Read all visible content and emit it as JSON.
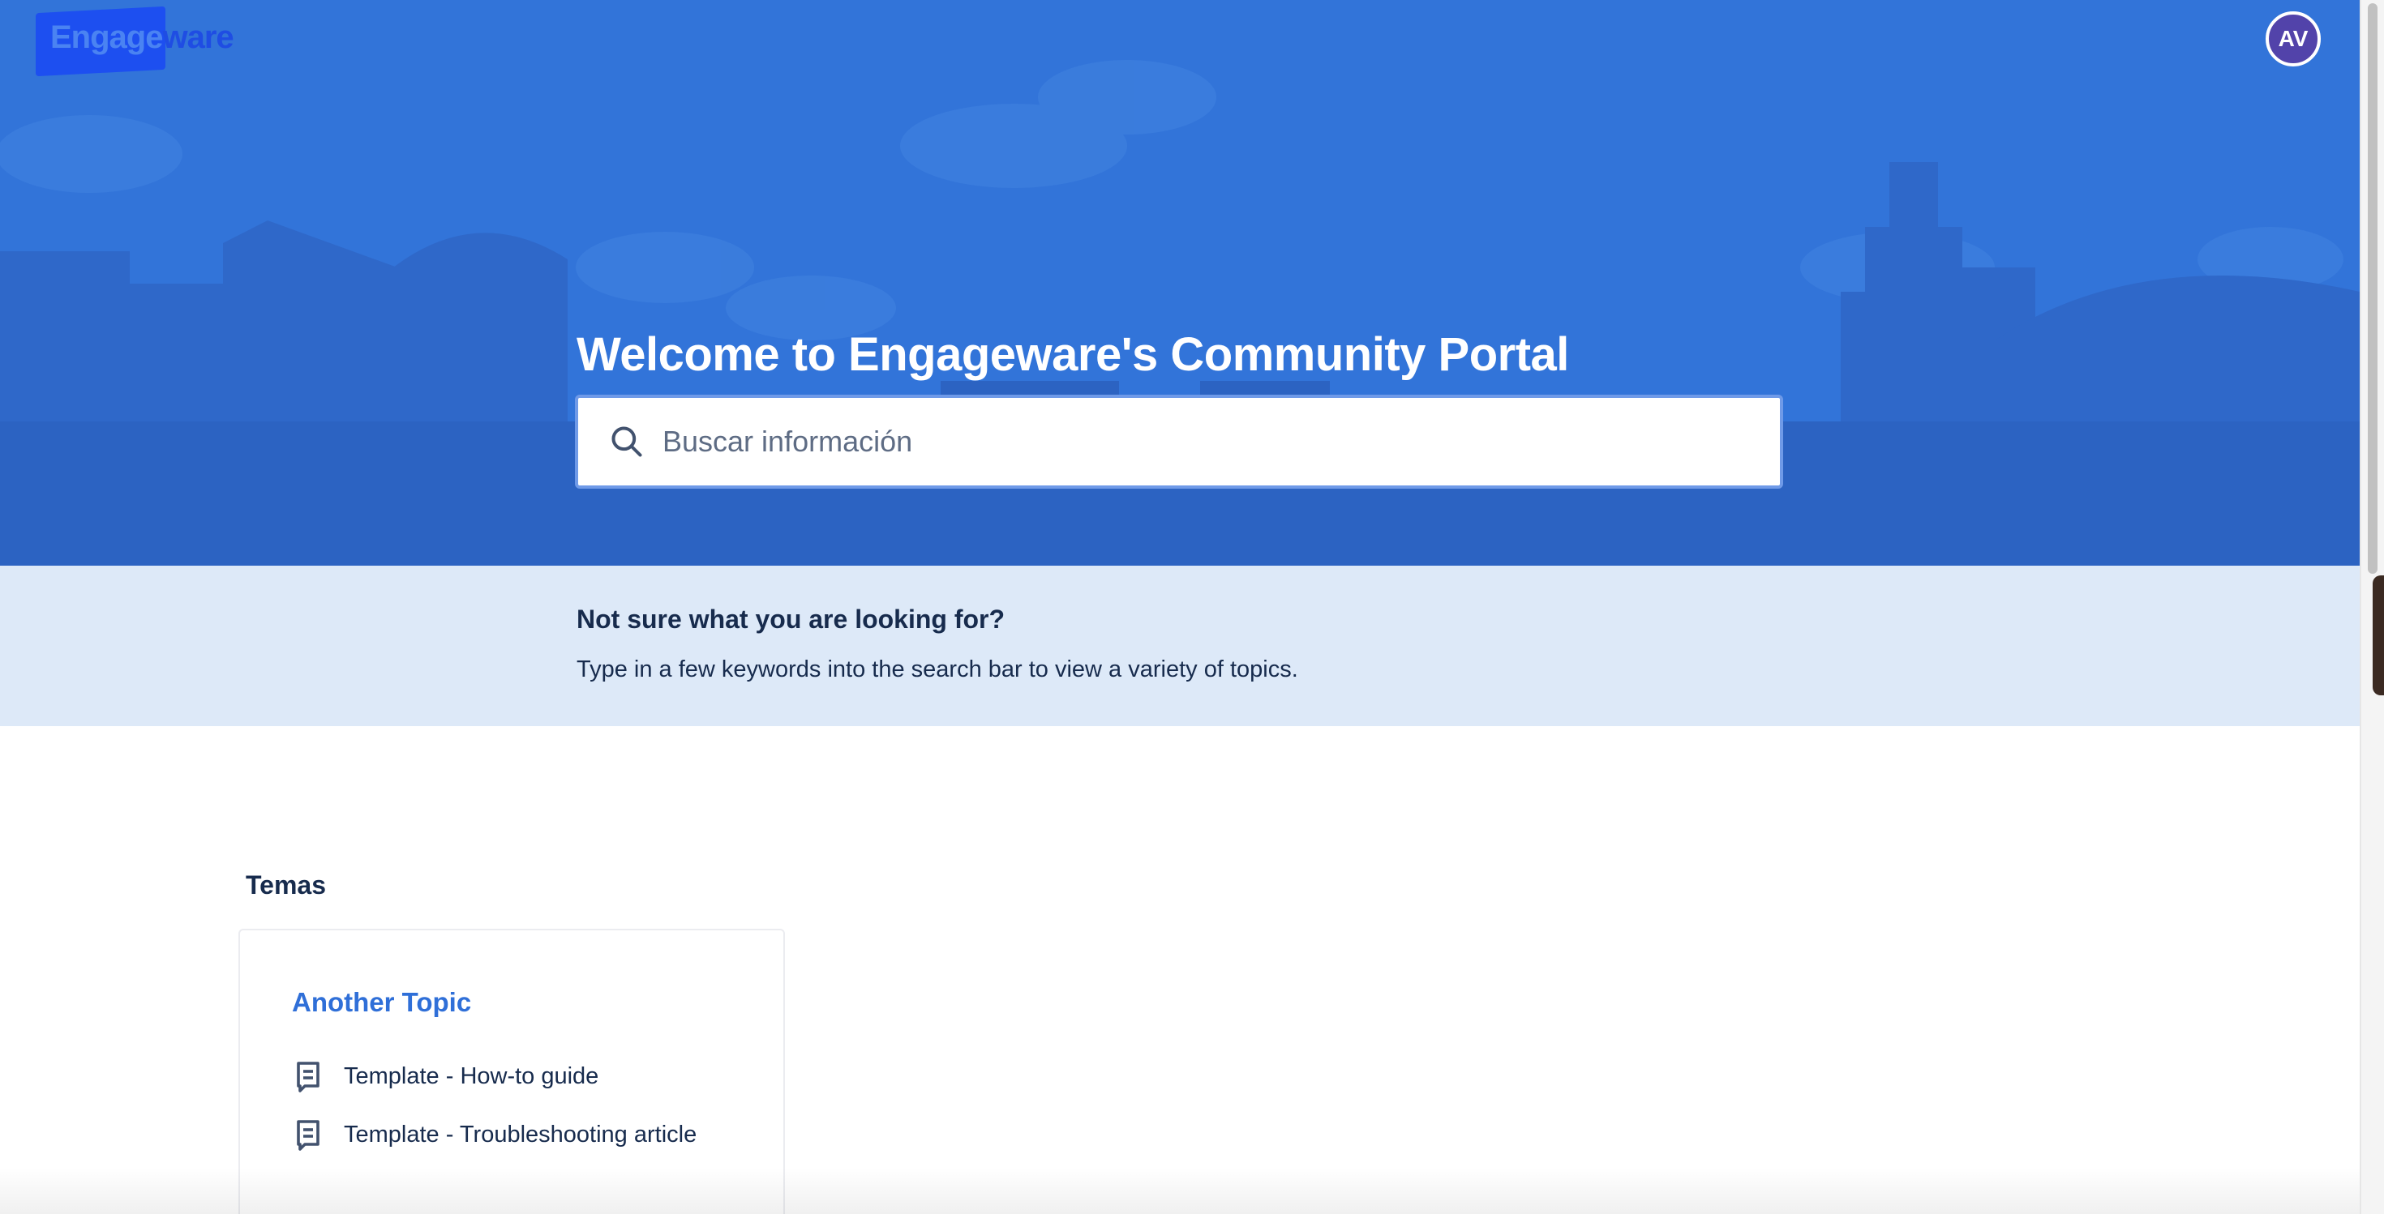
{
  "brand": {
    "logo_text_a": "Engage",
    "logo_text_b": "ware"
  },
  "user": {
    "avatar_initials": "AV",
    "avatar_color": "#5243aa"
  },
  "hero": {
    "title": "Welcome to Engageware's Community Portal",
    "background_color": "#3274d9"
  },
  "search": {
    "placeholder": "Buscar información",
    "value": "",
    "icon": "search-icon"
  },
  "hint": {
    "title": "Not sure what you are looking for?",
    "text": "Type in a few keywords into the search bar to view a variety of topics."
  },
  "topics": {
    "section_title": "Temas",
    "cards": [
      {
        "title": "Another Topic",
        "articles": [
          {
            "label": "Template - How-to guide",
            "icon": "article-icon"
          },
          {
            "label": "Template - Troubleshooting article",
            "icon": "article-icon"
          }
        ]
      }
    ]
  },
  "colors": {
    "accent": "#2f6fd8",
    "hint_band": "#dde9f8",
    "text": "#172b4d"
  }
}
